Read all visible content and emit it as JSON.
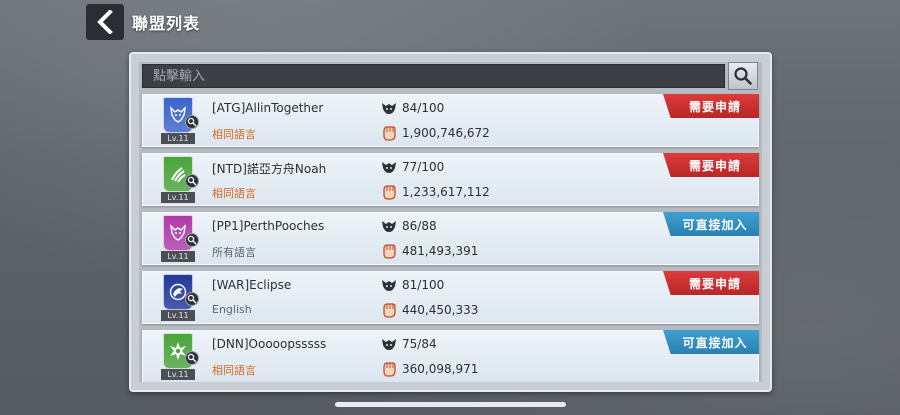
{
  "header": {
    "title": "聯盟列表"
  },
  "search": {
    "placeholder": "點擊輸入"
  },
  "colors": {
    "required": "#c83030",
    "direct": "#3590c4",
    "lang_match": "#d2691e"
  },
  "clans": [
    {
      "name": "[ATG]AllinTogether",
      "level": "Lv.11",
      "language": "相同語言",
      "lang_style": "orange",
      "members": "84/100",
      "power": "1,900,746,672",
      "status": "需要申請",
      "status_style": "red",
      "emblem_color": "#3a64c8",
      "emblem_icon": "wolf-icon"
    },
    {
      "name": "[NTD]諾亞方舟Noah",
      "level": "Lv.11",
      "language": "相同語言",
      "lang_style": "orange",
      "members": "77/100",
      "power": "1,233,617,112",
      "status": "需要申請",
      "status_style": "red",
      "emblem_color": "#4aa43a",
      "emblem_icon": "claw-icon"
    },
    {
      "name": "[PP1]PerthPooches",
      "level": "Lv.11",
      "language": "所有語言",
      "lang_style": "gray",
      "members": "86/88",
      "power": "481,493,391",
      "status": "可直接加入",
      "status_style": "blue",
      "emblem_color": "#b03aa8",
      "emblem_icon": "wolf-icon"
    },
    {
      "name": "[WAR]Eclipse",
      "level": "Lv.11",
      "language": "English",
      "lang_style": "gray",
      "members": "81/100",
      "power": "440,450,333",
      "status": "需要申請",
      "status_style": "red",
      "emblem_color": "#23379a",
      "emblem_icon": "eagle-icon"
    },
    {
      "name": "[DNN]Ooooopsssss",
      "level": "Lv.11",
      "language": "相同語言",
      "lang_style": "orange",
      "members": "75/84",
      "power": "360,098,971",
      "status": "可直接加入",
      "status_style": "blue",
      "emblem_color": "#4aa43a",
      "emblem_icon": "star-burst-icon"
    }
  ]
}
